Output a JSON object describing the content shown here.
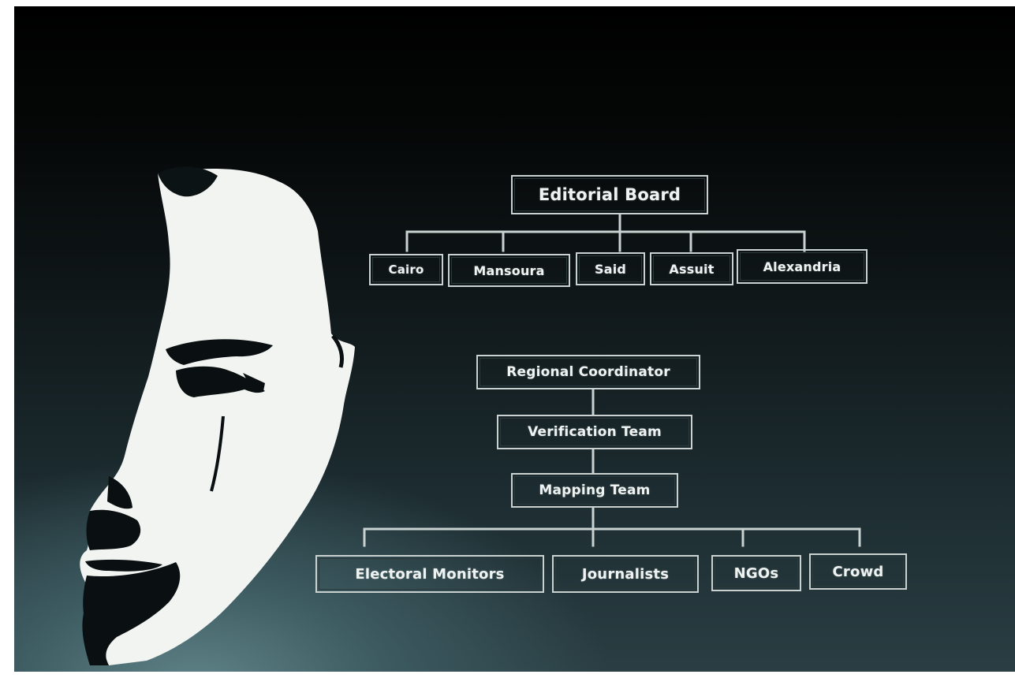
{
  "colors": {
    "box_border": "#c9d2d1",
    "box_text": "#eef3f2",
    "connector": "#c9d2d1",
    "face": "#f2f4f2"
  },
  "portrait": {
    "icon": "stylized-face-silhouette-icon"
  },
  "diagram": {
    "top": {
      "root": "Editorial Board",
      "children": [
        "Cairo",
        "Mansoura",
        "Said",
        "Assuit",
        "Alexandria"
      ]
    },
    "bottom": {
      "chain": [
        "Regional Coordinator",
        "Verification Team",
        "Mapping Team"
      ],
      "children": [
        "Electoral Monitors",
        "Journalists",
        "NGOs",
        "Crowd"
      ]
    }
  }
}
